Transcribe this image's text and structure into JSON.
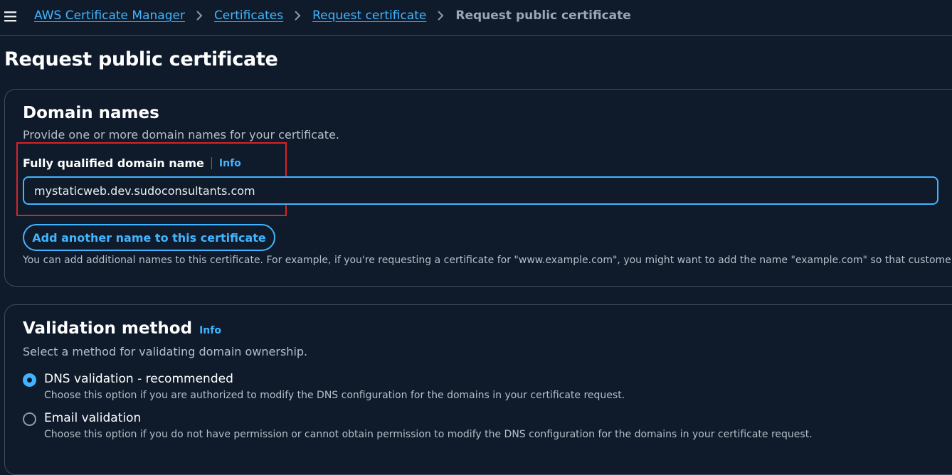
{
  "breadcrumb": {
    "items": [
      {
        "label": "AWS Certificate Manager"
      },
      {
        "label": "Certificates"
      },
      {
        "label": "Request certificate"
      }
    ],
    "current": "Request public certificate"
  },
  "page": {
    "title": "Request public certificate"
  },
  "domain_names": {
    "heading": "Domain names",
    "description": "Provide one or more domain names for your certificate.",
    "field_label": "Fully qualified domain name",
    "info_label": "Info",
    "input_value": "mystaticweb.dev.sudoconsultants.com",
    "add_button_label": "Add another name to this certificate",
    "hint": "You can add additional names to this certificate. For example, if you're requesting a certificate for \"www.example.com\", you might want to add the name \"example.com\" so that customers can"
  },
  "validation_method": {
    "heading": "Validation method",
    "info_label": "Info",
    "description": "Select a method for validating domain ownership.",
    "options": [
      {
        "label": "DNS validation - recommended",
        "description": "Choose this option if you are authorized to modify the DNS configuration for the domains in your certificate request.",
        "selected": true
      },
      {
        "label": "Email validation",
        "description": "Choose this option if you do not have permission or cannot obtain permission to modify the DNS configuration for the domains in your certificate request.",
        "selected": false
      }
    ]
  },
  "colors": {
    "background": "#0f1b2a",
    "link": "#42b4ff",
    "highlight": "#d8232a"
  },
  "icons": {
    "menu": "hamburger-menu-icon",
    "separator": "chevron-right-icon"
  }
}
